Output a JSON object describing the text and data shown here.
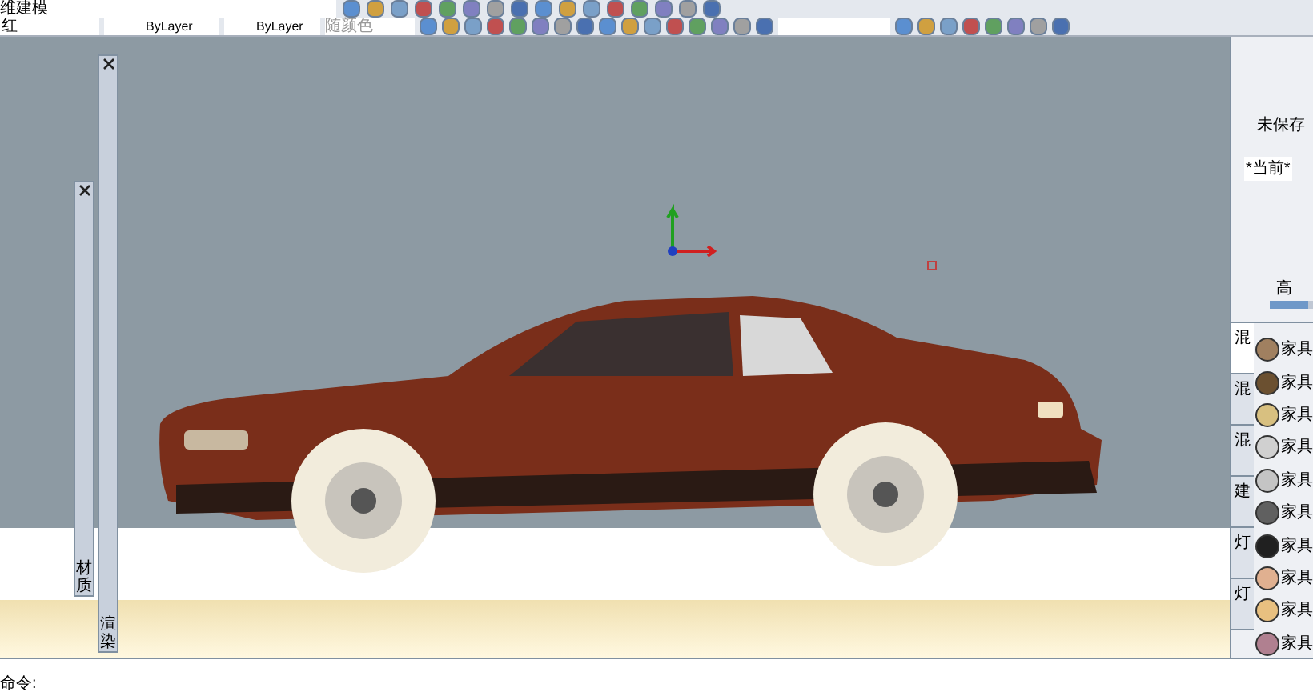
{
  "workspace": {
    "value": "维建模"
  },
  "properties": {
    "color_name": "红",
    "linetype": "ByLayer",
    "lineweight": "ByLayer",
    "plotstyle": "随颜色"
  },
  "palettes": [
    {
      "label": "材质"
    },
    {
      "label": "渲染"
    }
  ],
  "right_panel": {
    "file": "未保存",
    "preset": "*当前*",
    "quality": "高",
    "level": 0.9
  },
  "tool_tabs": [
    {
      "label": "混",
      "selected": true
    },
    {
      "label": "混",
      "selected": false
    },
    {
      "label": "混",
      "selected": false
    },
    {
      "label": "建",
      "selected": false
    },
    {
      "label": "灯",
      "selected": false
    },
    {
      "label": "灯",
      "selected": false
    }
  ],
  "materials": [
    {
      "label": "家具",
      "color": "#a08060"
    },
    {
      "label": "家具",
      "color": "#6b5030"
    },
    {
      "label": "家具",
      "color": "#d8c080"
    },
    {
      "label": "家具",
      "color": "#d0d0d0"
    },
    {
      "label": "家具",
      "color": "#c4c4c4"
    },
    {
      "label": "家具",
      "color": "#606060"
    },
    {
      "label": "家具",
      "color": "#202020"
    },
    {
      "label": "家具",
      "color": "#e0b090"
    },
    {
      "label": "家具",
      "color": "#e8c080"
    },
    {
      "label": "家具",
      "color": "#b08090"
    }
  ],
  "command_line": {
    "prompt": "命令:"
  }
}
